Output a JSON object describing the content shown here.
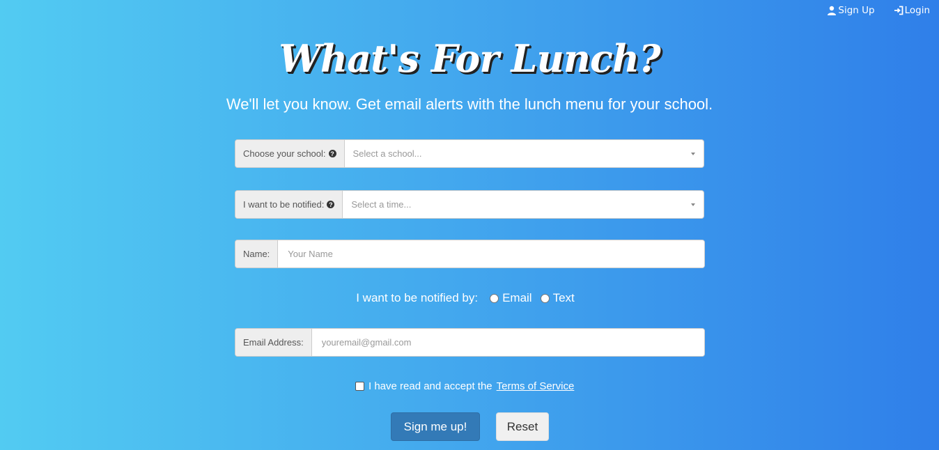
{
  "nav": {
    "signup_label": "Sign Up",
    "login_label": "Login",
    "signup_icon": "user-icon",
    "login_icon": "login-icon"
  },
  "hero": {
    "title": "What's For Lunch?",
    "subtitle": "We'll let you know. Get email alerts with the lunch menu for your school."
  },
  "form": {
    "school": {
      "label": "Choose your school:",
      "placeholder": "Select a school..."
    },
    "time": {
      "label": "I want to be notified:",
      "placeholder": "Select a time..."
    },
    "name": {
      "label": "Name:",
      "placeholder": "Your Name"
    },
    "notify_by": {
      "label": "I want to be notified by:",
      "options": [
        "Email",
        "Text"
      ]
    },
    "email": {
      "label": "Email Address:",
      "placeholder": "youremail@gmail.com"
    },
    "terms": {
      "prefix": "I have read and accept the",
      "link": "Terms of Service"
    },
    "submit_label": "Sign me up!",
    "reset_label": "Reset"
  }
}
